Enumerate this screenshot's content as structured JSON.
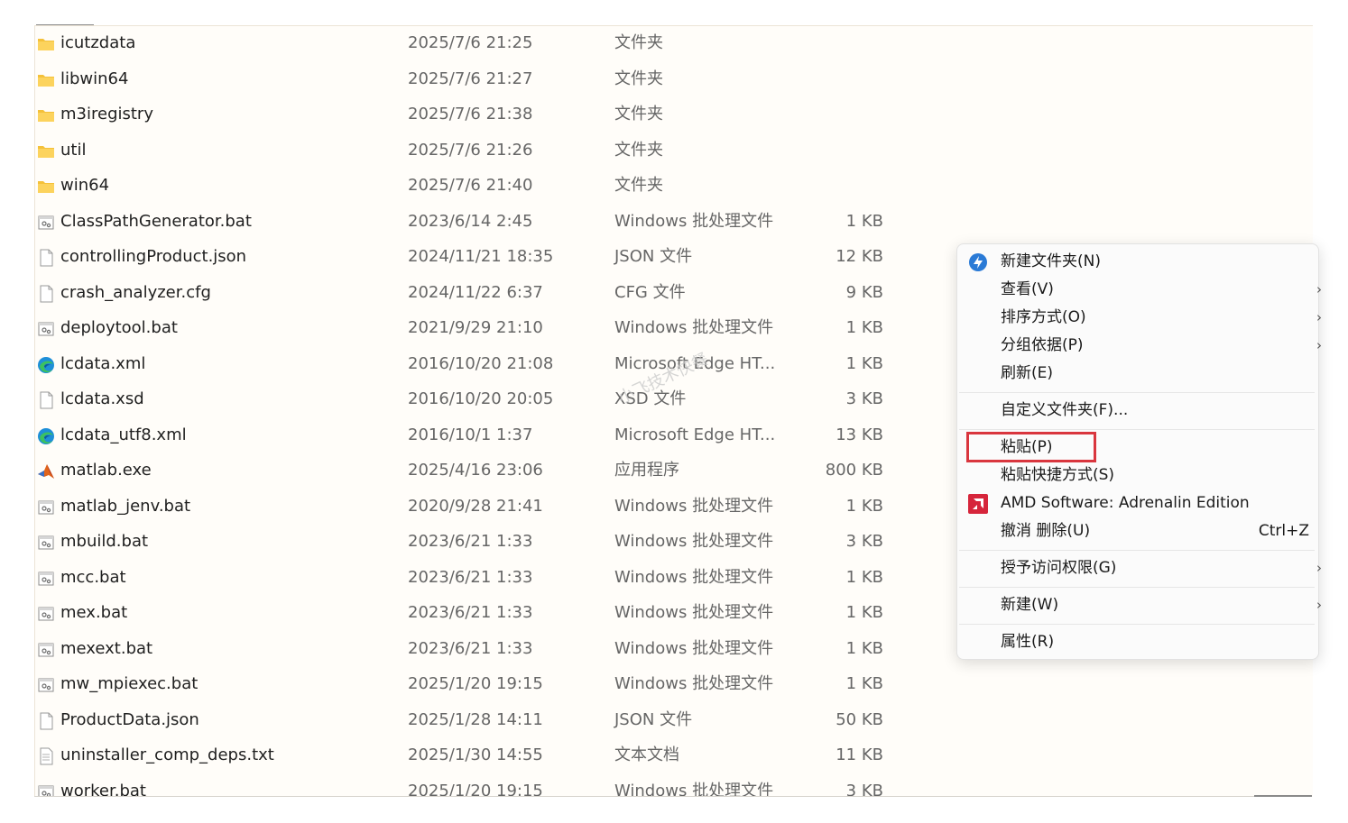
{
  "files": [
    {
      "icon": "folder-icon",
      "name": "icutzdata",
      "date": "2025/7/6 21:25",
      "type": "文件夹",
      "size": ""
    },
    {
      "icon": "folder-icon",
      "name": "libwin64",
      "date": "2025/7/6 21:27",
      "type": "文件夹",
      "size": ""
    },
    {
      "icon": "folder-icon",
      "name": "m3iregistry",
      "date": "2025/7/6 21:38",
      "type": "文件夹",
      "size": ""
    },
    {
      "icon": "folder-icon",
      "name": "util",
      "date": "2025/7/6 21:26",
      "type": "文件夹",
      "size": ""
    },
    {
      "icon": "folder-icon",
      "name": "win64",
      "date": "2025/7/6 21:40",
      "type": "文件夹",
      "size": ""
    },
    {
      "icon": "batch-file-icon",
      "name": "ClassPathGenerator.bat",
      "date": "2023/6/14 2:45",
      "type": "Windows 批处理文件",
      "size": "1 KB"
    },
    {
      "icon": "file-icon",
      "name": "controllingProduct.json",
      "date": "2024/11/21 18:35",
      "type": "JSON 文件",
      "size": "12 KB"
    },
    {
      "icon": "file-icon",
      "name": "crash_analyzer.cfg",
      "date": "2024/11/22 6:37",
      "type": "CFG 文件",
      "size": "9 KB"
    },
    {
      "icon": "batch-file-icon",
      "name": "deploytool.bat",
      "date": "2021/9/29 21:10",
      "type": "Windows 批处理文件",
      "size": "1 KB"
    },
    {
      "icon": "edge-icon",
      "name": "lcdata.xml",
      "date": "2016/10/20 21:08",
      "type": "Microsoft Edge HT...",
      "size": "1 KB"
    },
    {
      "icon": "file-icon",
      "name": "lcdata.xsd",
      "date": "2016/10/20 20:05",
      "type": "XSD 文件",
      "size": "3 KB"
    },
    {
      "icon": "edge-icon",
      "name": "lcdata_utf8.xml",
      "date": "2016/10/1 1:37",
      "type": "Microsoft Edge HT...",
      "size": "13 KB"
    },
    {
      "icon": "matlab-icon",
      "name": "matlab.exe",
      "date": "2025/4/16 23:06",
      "type": "应用程序",
      "size": "800 KB"
    },
    {
      "icon": "batch-file-icon",
      "name": "matlab_jenv.bat",
      "date": "2020/9/28 21:41",
      "type": "Windows 批处理文件",
      "size": "1 KB"
    },
    {
      "icon": "batch-file-icon",
      "name": "mbuild.bat",
      "date": "2023/6/21 1:33",
      "type": "Windows 批处理文件",
      "size": "3 KB"
    },
    {
      "icon": "batch-file-icon",
      "name": "mcc.bat",
      "date": "2023/6/21 1:33",
      "type": "Windows 批处理文件",
      "size": "1 KB"
    },
    {
      "icon": "batch-file-icon",
      "name": "mex.bat",
      "date": "2023/6/21 1:33",
      "type": "Windows 批处理文件",
      "size": "1 KB"
    },
    {
      "icon": "batch-file-icon",
      "name": "mexext.bat",
      "date": "2023/6/21 1:33",
      "type": "Windows 批处理文件",
      "size": "1 KB"
    },
    {
      "icon": "batch-file-icon",
      "name": "mw_mpiexec.bat",
      "date": "2025/1/20 19:15",
      "type": "Windows 批处理文件",
      "size": "1 KB"
    },
    {
      "icon": "file-icon",
      "name": "ProductData.json",
      "date": "2025/1/28 14:11",
      "type": "JSON 文件",
      "size": "50 KB"
    },
    {
      "icon": "text-file-icon",
      "name": "uninstaller_comp_deps.txt",
      "date": "2025/1/30 14:55",
      "type": "文本文档",
      "size": "11 KB"
    },
    {
      "icon": "batch-file-icon",
      "name": "worker.bat",
      "date": "2025/1/20 19:15",
      "type": "Windows 批处理文件",
      "size": "3 KB"
    }
  ],
  "watermark": "小飞技术快餐",
  "context_menu": {
    "items": [
      {
        "label": "新建文件夹(N)",
        "icon": "new-folder-icon"
      },
      {
        "label": "查看(V)",
        "arrow": "›"
      },
      {
        "label": "排序方式(O)",
        "arrow": "›"
      },
      {
        "label": "分组依据(P)",
        "arrow": "›"
      },
      {
        "label": "刷新(E)"
      },
      {
        "label": "自定义文件夹(F)..."
      },
      {
        "label": "粘贴(P)",
        "highlighted": true
      },
      {
        "label": "粘贴快捷方式(S)"
      },
      {
        "label": "AMD Software: Adrenalin Edition",
        "icon": "amd-icon"
      },
      {
        "label": "撤消 删除(U)",
        "shortcut": "Ctrl+Z"
      },
      {
        "label": "授予访问权限(G)",
        "arrow": "›"
      },
      {
        "label": "新建(W)",
        "arrow": "›"
      },
      {
        "label": "属性(R)"
      }
    ],
    "highlight_color": "#d9363e"
  }
}
